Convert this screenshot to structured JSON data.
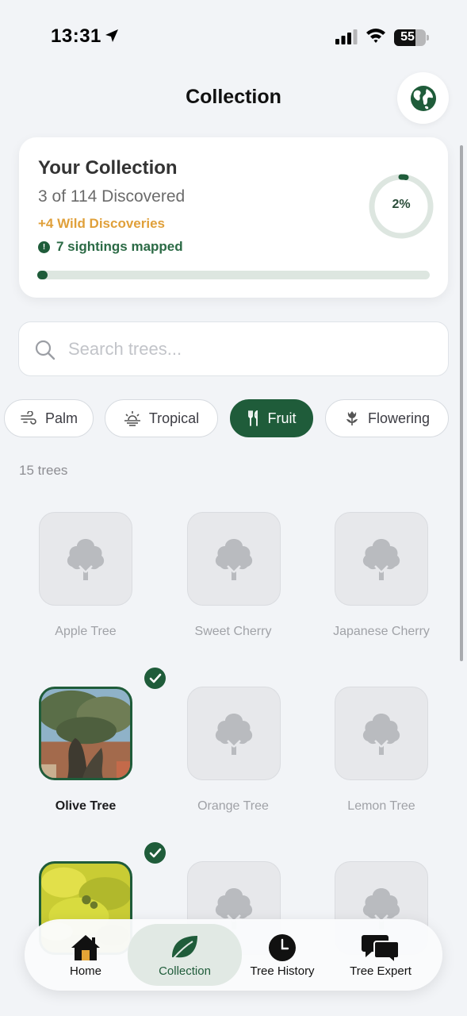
{
  "status": {
    "time": "13:31",
    "battery": "55"
  },
  "header": {
    "title": "Collection",
    "globe_icon": "globe-icon"
  },
  "summary": {
    "title": "Your Collection",
    "count_text": "3 of 114 Discovered",
    "wild_text": "+4 Wild Discoveries",
    "sightings_text": "7 sightings mapped",
    "percent_label": "2%",
    "progress_fraction": 0.026
  },
  "search": {
    "placeholder": "Search trees..."
  },
  "filters": [
    {
      "label": "Palm",
      "icon": "wind-icon",
      "active": false
    },
    {
      "label": "Tropical",
      "icon": "sunrise-icon",
      "active": false
    },
    {
      "label": "Fruit",
      "icon": "fork-knife-icon",
      "active": true
    },
    {
      "label": "Flowering",
      "icon": "tulip-icon",
      "active": false
    }
  ],
  "tree_count": "15 trees",
  "trees": [
    {
      "name": "Apple Tree",
      "discovered": false
    },
    {
      "name": "Sweet Cherry",
      "discovered": false
    },
    {
      "name": "Japanese Cherry",
      "discovered": false
    },
    {
      "name": "Olive Tree",
      "discovered": true
    },
    {
      "name": "Orange Tree",
      "discovered": false
    },
    {
      "name": "Lemon Tree",
      "discovered": false
    },
    {
      "name": "",
      "discovered": true
    },
    {
      "name": "",
      "discovered": false
    },
    {
      "name": "",
      "discovered": false
    }
  ],
  "tabs": [
    {
      "label": "Home",
      "icon": "house-icon",
      "active": false
    },
    {
      "label": "Collection",
      "icon": "leaf-icon",
      "active": true
    },
    {
      "label": "Tree History",
      "icon": "clock-icon",
      "active": false
    },
    {
      "label": "Tree Expert",
      "icon": "chat-bubbles-icon",
      "active": false
    }
  ],
  "colors": {
    "accent": "#1f5c3a",
    "wild": "#e0a03a",
    "background": "#f2f4f7"
  }
}
